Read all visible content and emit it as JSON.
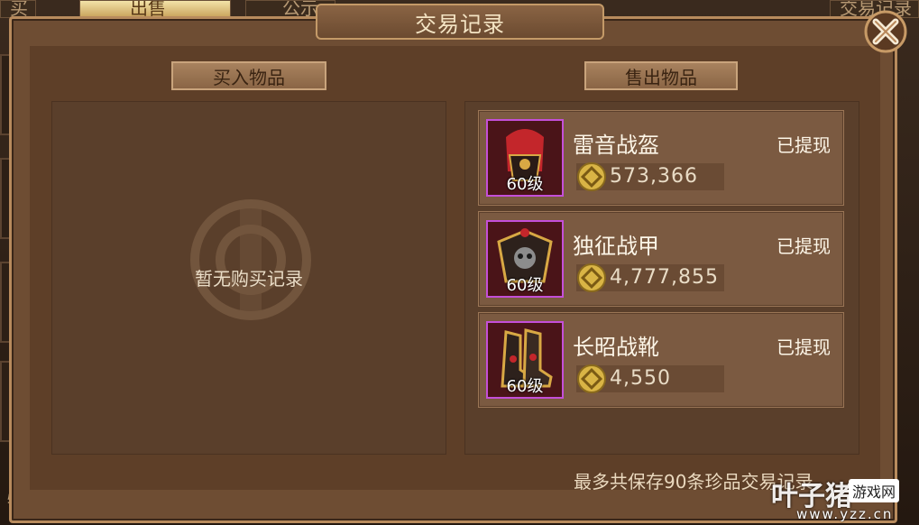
{
  "background": {
    "tabs": [
      "买",
      "出售",
      "公示",
      "交易记录"
    ],
    "bottom_text": "物"
  },
  "dialog": {
    "title": "交易记录",
    "close_icon": "close-x-icon"
  },
  "buy_section": {
    "label": "买入物品",
    "empty_text": "暂无购买记录"
  },
  "sell_section": {
    "label": "售出物品",
    "items": [
      {
        "name": "雷音战盔",
        "level": "60级",
        "status": "已提现",
        "price": "573,366",
        "icon": "helmet-icon"
      },
      {
        "name": "独征战甲",
        "level": "60级",
        "status": "已提现",
        "price": "4,777,855",
        "icon": "armor-icon"
      },
      {
        "name": "长昭战靴",
        "level": "60级",
        "status": "已提现",
        "price": "4,550",
        "icon": "boots-icon"
      }
    ]
  },
  "footer_note": "最多共保存90条珍品交易记录",
  "watermark": {
    "main": "叶子猪",
    "badge": "游戏网",
    "url": "www.yzz.cn"
  },
  "colors": {
    "rarity_border": "#c44fd8",
    "panel": "#5a3f2b",
    "text": "#fdf6e8"
  }
}
